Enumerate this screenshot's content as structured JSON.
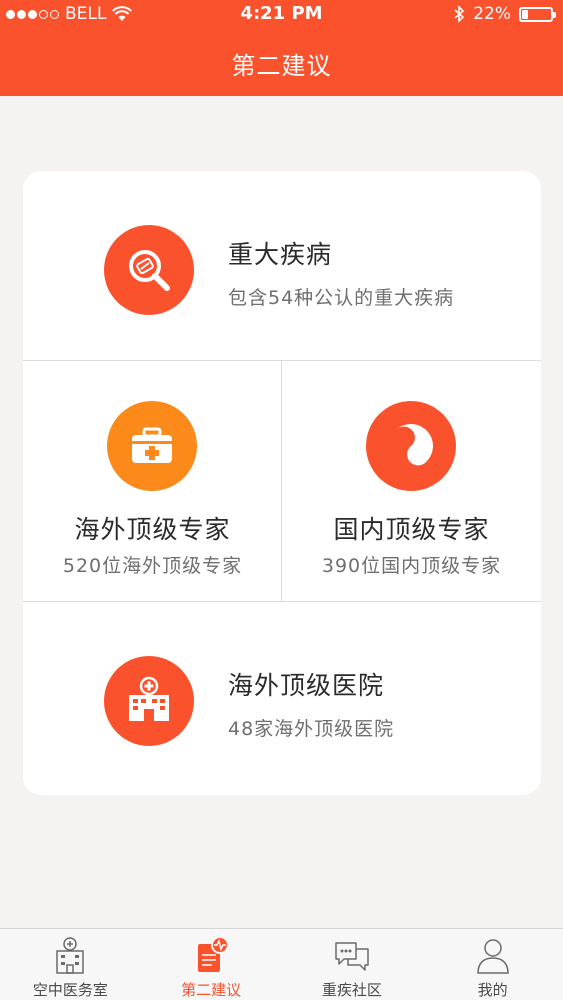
{
  "status_bar": {
    "carrier": "BELL",
    "time": "4:21 PM",
    "battery": "22%",
    "battery_level": 0.22,
    "signal_dots_filled": 3,
    "signal_dots_total": 5
  },
  "nav": {
    "title": "第二建议"
  },
  "colors": {
    "brand": "#fb522e",
    "orange": "#fb8a1b",
    "text_dark": "#2b2b2b",
    "text_muted": "#6f6f6f"
  },
  "services": {
    "major_disease": {
      "title": "重大疾病",
      "subtitle": "包含54种公认的重大疾病",
      "icon": "magnifier-icon"
    },
    "overseas_experts": {
      "title": "海外顶级专家",
      "subtitle": "520位海外顶级专家",
      "icon": "medical-kit-icon"
    },
    "domestic_experts": {
      "title": "国内顶级专家",
      "subtitle": "390位国内顶级专家",
      "icon": "yin-yang-icon"
    },
    "overseas_hospitals": {
      "title": "海外顶级医院",
      "subtitle": "48家海外顶级医院",
      "icon": "hospital-icon"
    }
  },
  "tabs": [
    {
      "label": "空中医务室",
      "icon": "clinic-building-icon",
      "active": false
    },
    {
      "label": "第二建议",
      "icon": "report-icon",
      "active": true
    },
    {
      "label": "重疾社区",
      "icon": "chat-bubbles-icon",
      "active": false
    },
    {
      "label": "我的",
      "icon": "user-icon",
      "active": false
    }
  ]
}
